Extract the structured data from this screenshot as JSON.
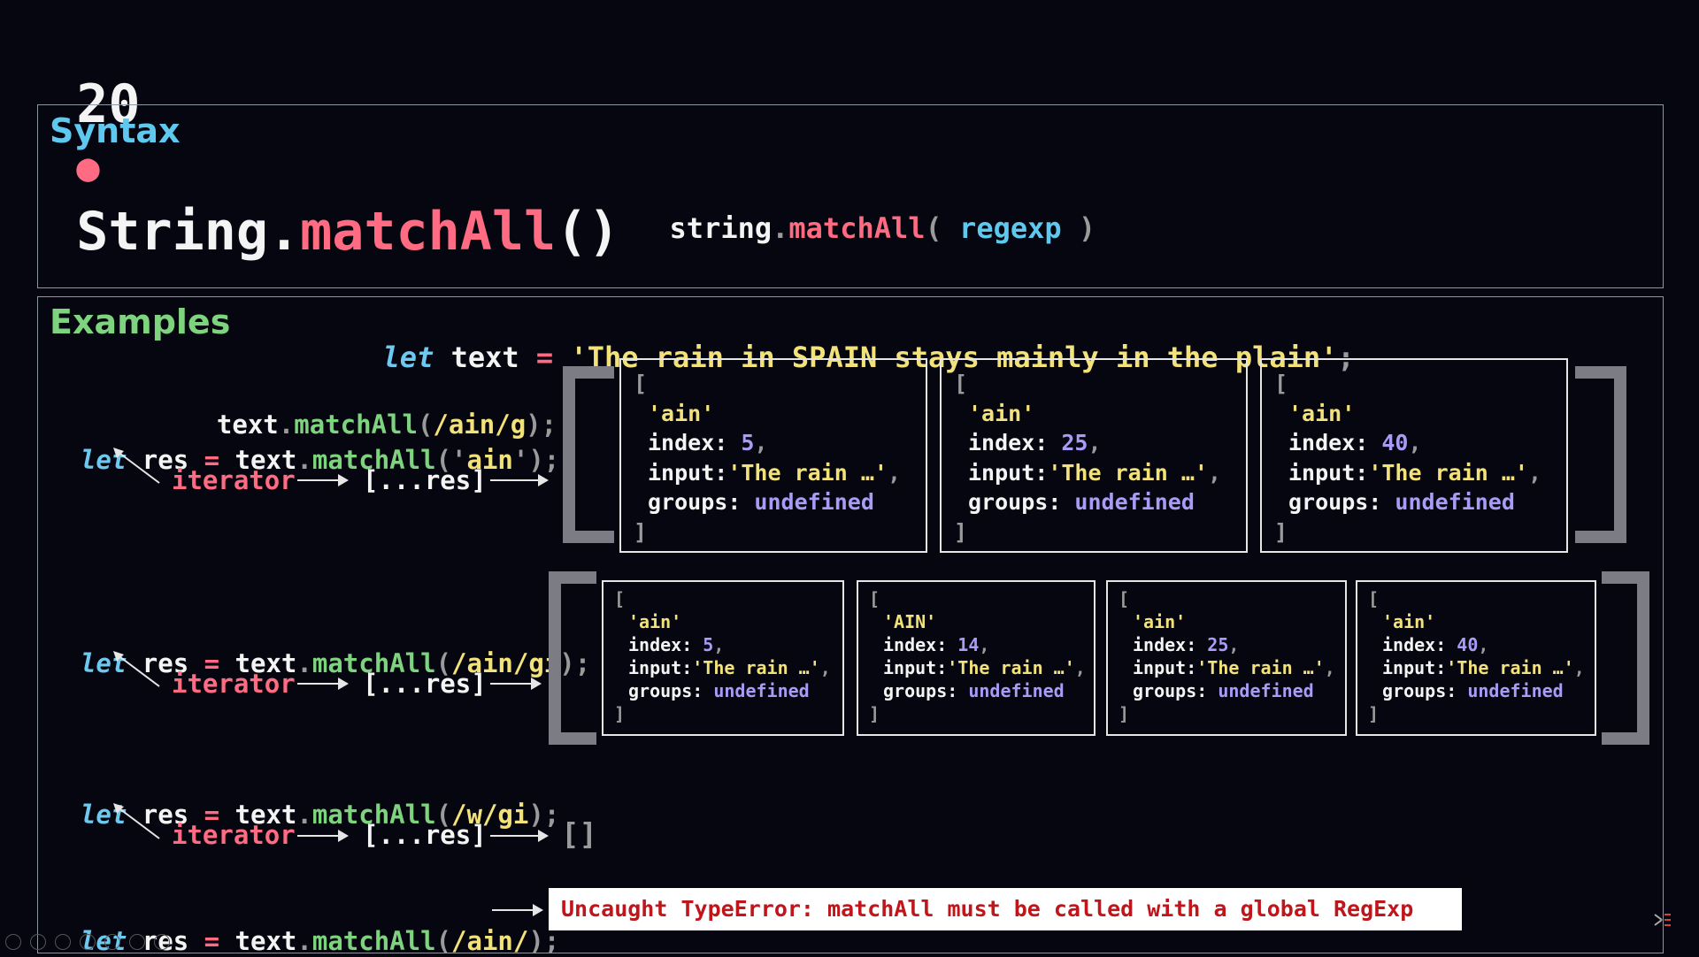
{
  "title": {
    "number": "20",
    "bullet": "●",
    "object": "String",
    "dot": ".",
    "method": "matchAll",
    "parens": "()"
  },
  "syntax": {
    "heading": "Syntax",
    "receiver": "string",
    "dot": ".",
    "method": "matchAll",
    "open": "(",
    "param": " regexp ",
    "close": ")"
  },
  "examples": {
    "heading": "Examples",
    "decl": {
      "kw": "let",
      "name": " text ",
      "eq": "=",
      "str": " 'The rain in SPAIN stays mainly in the plain'",
      "semi": ";"
    },
    "common": {
      "let": "let",
      "res": " res ",
      "eq": "=",
      "text": " text",
      "dot": ".",
      "method": "matchAll",
      "iterator": "iterator",
      "spread": "[...res]",
      "semi": ";"
    },
    "ex1": {
      "alt_line": {
        "text": "text",
        "dot": ".",
        "method": "matchAll",
        "open": "(",
        "regex": "/ain/g",
        "close": ")",
        "semi": ";"
      },
      "arg_open": "('",
      "arg": "ain",
      "arg_close": "')",
      "objects": [
        {
          "open": "[",
          "match": "'ain'",
          "index_label": "index:",
          "index": "5",
          "input_label": "input:",
          "input": "'The rain …'",
          "groups_label": "groups:",
          "groups": "undefined",
          "close": "]"
        },
        {
          "open": "[",
          "match": "'ain'",
          "index_label": "index:",
          "index": "25",
          "input_label": "input:",
          "input": "'The rain …'",
          "groups_label": "groups:",
          "groups": "undefined",
          "close": "]"
        },
        {
          "open": "[",
          "match": "'ain'",
          "index_label": "index:",
          "index": "40",
          "input_label": "input:",
          "input": "'The rain …'",
          "groups_label": "groups:",
          "groups": "undefined",
          "close": "]"
        }
      ]
    },
    "ex2": {
      "open": "(",
      "regex": "/ain/gi",
      "close": ")",
      "objects": [
        {
          "open": "[",
          "match": "'ain'",
          "index_label": "index:",
          "index": "5",
          "input_label": "input:",
          "input": "'The rain …'",
          "groups_label": "groups:",
          "groups": "undefined",
          "close": "]"
        },
        {
          "open": "[",
          "match": "'AIN'",
          "index_label": "index:",
          "index": "14",
          "input_label": "input:",
          "input": "'The rain …'",
          "groups_label": "groups:",
          "groups": "undefined",
          "close": "]"
        },
        {
          "open": "[",
          "match": "'ain'",
          "index_label": "index:",
          "index": "25",
          "input_label": "input:",
          "input": "'The rain …'",
          "groups_label": "groups:",
          "groups": "undefined",
          "close": "]"
        },
        {
          "open": "[",
          "match": "'ain'",
          "index_label": "index:",
          "index": "40",
          "input_label": "input:",
          "input": "'The rain …'",
          "groups_label": "groups:",
          "groups": "undefined",
          "close": "]"
        }
      ]
    },
    "ex3": {
      "open": "(",
      "regex": "/w/gi",
      "close": ")",
      "result": "[]"
    },
    "ex4": {
      "open": "(",
      "regex": "/ain/",
      "close": ")",
      "error": "Uncaught TypeError: matchAll must be called with a global RegExp"
    }
  }
}
